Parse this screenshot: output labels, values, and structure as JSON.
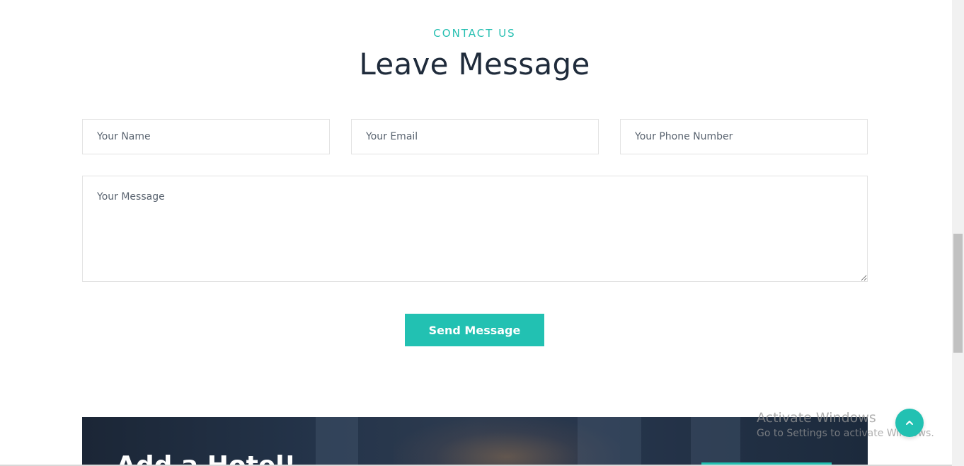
{
  "contact": {
    "kicker": "CONTACT US",
    "title": "Leave Message"
  },
  "form": {
    "name_placeholder": "Your Name",
    "email_placeholder": "Your Email",
    "phone_placeholder": "Your Phone Number",
    "message_placeholder": "Your Message",
    "submit_label": "Send Message"
  },
  "banner": {
    "title": "Add a Hotel!"
  },
  "watermark": {
    "title": "Activate Windows",
    "subtitle": "Go to Settings to activate Windows."
  },
  "icons": {
    "back_to_top": "chevron-up-icon"
  },
  "colors": {
    "accent": "#22c1b2",
    "heading": "#1f2b3b",
    "banner_bg": "#1b2636"
  }
}
